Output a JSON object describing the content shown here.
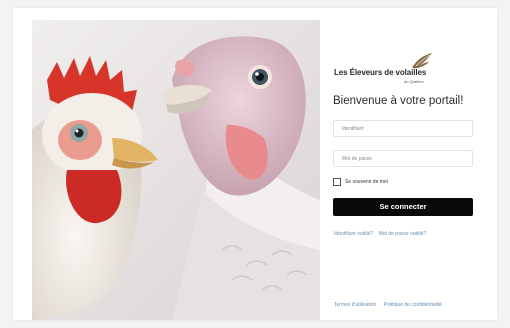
{
  "brand": {
    "name": "Les Éleveurs de volailles",
    "region": "du Québec",
    "accent_color": "#8b6b4a"
  },
  "login": {
    "welcome": "Bienvenue à votre portail!",
    "username_placeholder": "Identifiant",
    "password_placeholder": "Mot de passe",
    "remember_label": "Se souvenir de moi",
    "submit_label": "Se connecter",
    "forgot_username": "Identifiant oublié?",
    "forgot_password": "Mot de passe oublié?"
  },
  "footer": {
    "terms": "Termes d'utilisation",
    "privacy": "Politique de confidentialité"
  },
  "colors": {
    "button_bg": "#0a0a0a",
    "link": "#6a8fb0"
  }
}
